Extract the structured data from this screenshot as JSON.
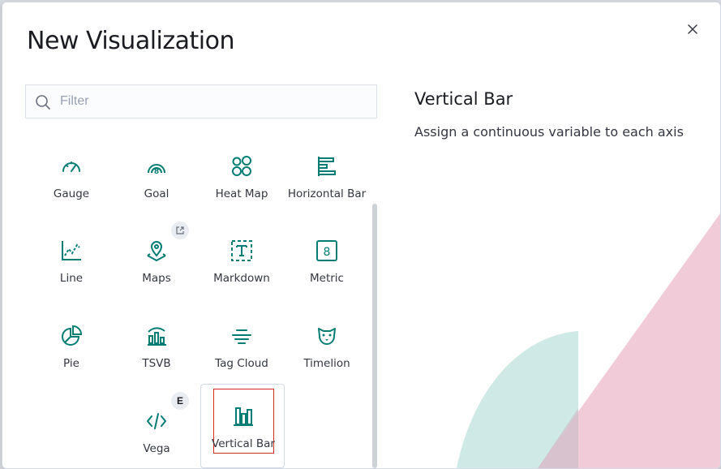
{
  "modal": {
    "title": "New Visualization",
    "close_icon": "close-icon"
  },
  "search": {
    "placeholder": "Filter",
    "value": ""
  },
  "types": [
    {
      "label": "Gauge",
      "icon": "gauge-icon"
    },
    {
      "label": "Goal",
      "icon": "goal-icon"
    },
    {
      "label": "Heat Map",
      "icon": "heatmap-icon"
    },
    {
      "label": "Horizontal Bar",
      "icon": "horizontal-bar-icon"
    },
    {
      "label": "Line",
      "icon": "line-chart-icon"
    },
    {
      "label": "Maps",
      "icon": "maps-icon",
      "badge_icon": "external-link-icon"
    },
    {
      "label": "Markdown",
      "icon": "markdown-icon"
    },
    {
      "label": "Metric",
      "icon": "metric-icon"
    },
    {
      "label": "Pie",
      "icon": "pie-chart-icon"
    },
    {
      "label": "TSVB",
      "icon": "tsvb-icon"
    },
    {
      "label": "Tag Cloud",
      "icon": "tag-cloud-icon"
    },
    {
      "label": "Timelion",
      "icon": "timelion-icon"
    },
    {
      "label": "Vega",
      "icon": "code-icon",
      "badge": "E"
    },
    {
      "label": "Vertical Bar",
      "icon": "vertical-bar-icon",
      "selected": true
    }
  ],
  "description": {
    "title": "Vertical Bar",
    "text": "Assign a continuous variable to each axis"
  },
  "colors": {
    "icon": "#017d73",
    "selection_outline": "#d62d20",
    "deco_pink": "#f0c7d4",
    "deco_teal": "#cfeae6"
  }
}
